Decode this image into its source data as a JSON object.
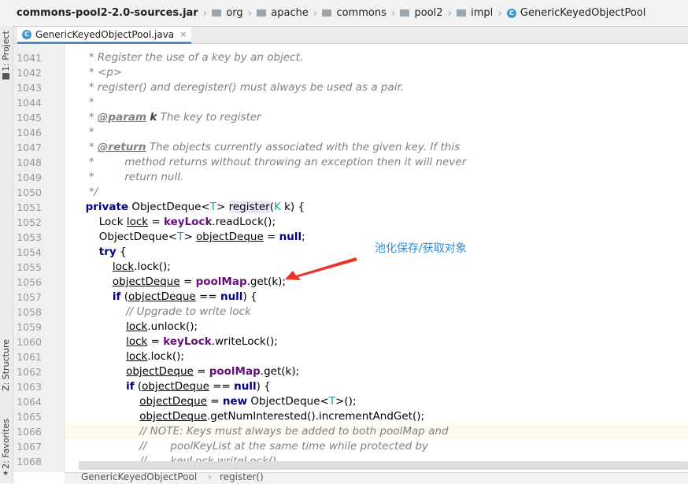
{
  "breadcrumbs": [
    {
      "label": "commons-pool2-2.0-sources.jar",
      "icon": "jar"
    },
    {
      "label": "org",
      "icon": "folder-icon"
    },
    {
      "label": "apache",
      "icon": "folder-icon"
    },
    {
      "label": "commons",
      "icon": "folder-icon"
    },
    {
      "label": "pool2",
      "icon": "folder-icon"
    },
    {
      "label": "impl",
      "icon": "folder-icon"
    },
    {
      "label": "GenericKeyedObjectPool",
      "icon": "class-icon"
    }
  ],
  "left_panel": {
    "project_tab": "1: Project",
    "structure_tab": "Z: Structure",
    "favorites_tab": "2: Favorites"
  },
  "editor_tab": {
    "label": "GenericKeyedObjectPool.java",
    "close": "×",
    "icon_letter": "C"
  },
  "line_numbers": [
    "1041",
    "1042",
    "1043",
    "1044",
    "1045",
    "1046",
    "1047",
    "1048",
    "1049",
    "1050",
    "1051",
    "1052",
    "1053",
    "1054",
    "1055",
    "1056",
    "1057",
    "1058",
    "1059",
    "1060",
    "1061",
    "1062",
    "1063",
    "1064",
    "1065",
    "1066",
    "1067",
    "1068"
  ],
  "code_lines": [
    [
      [
        "cm",
        "   * Register the use of a key by an object."
      ]
    ],
    [
      [
        "cm",
        "   * <p>"
      ]
    ],
    [
      [
        "cm",
        "   * register() and deregister() must always be used as a pair."
      ]
    ],
    [
      [
        "cm",
        "   *"
      ]
    ],
    [
      [
        "cm",
        "   * "
      ],
      [
        "doctag",
        "@param"
      ],
      [
        "cm",
        " "
      ],
      [
        "docparam",
        "k"
      ],
      [
        "cm",
        " The key to register"
      ]
    ],
    [
      [
        "cm",
        "   *"
      ]
    ],
    [
      [
        "cm",
        "   * "
      ],
      [
        "doctag",
        "@return"
      ],
      [
        "cm",
        " The objects currently associated with the given key. If this"
      ]
    ],
    [
      [
        "cm",
        "   *         method returns without throwing an exception then it will never"
      ]
    ],
    [
      [
        "cm",
        "   *         return null."
      ]
    ],
    [
      [
        "cm",
        "   */"
      ]
    ],
    [
      [
        "",
        "  "
      ],
      [
        "kw",
        "private"
      ],
      [
        "",
        " ObjectDeque<"
      ],
      [
        "tparam",
        "T"
      ],
      [
        "",
        "> "
      ],
      [
        "hlm",
        "register"
      ],
      [
        "",
        "("
      ],
      [
        "tparam",
        "K"
      ],
      [
        "",
        " k) {"
      ]
    ],
    [
      [
        "",
        "      Lock "
      ],
      [
        "ul",
        "lock"
      ],
      [
        "",
        " = "
      ],
      [
        "field",
        "keyLock"
      ],
      [
        "",
        ".readLock();"
      ]
    ],
    [
      [
        "",
        "      ObjectDeque<"
      ],
      [
        "tparam",
        "T"
      ],
      [
        "",
        "> "
      ],
      [
        "ul",
        "objectDeque"
      ],
      [
        "",
        " = "
      ],
      [
        "kw",
        "null"
      ],
      [
        "",
        ";"
      ]
    ],
    [
      [
        "",
        "      "
      ],
      [
        "kw",
        "try"
      ],
      [
        "",
        " {"
      ]
    ],
    [
      [
        "",
        "          "
      ],
      [
        "ul",
        "lock"
      ],
      [
        "",
        ".lock();"
      ]
    ],
    [
      [
        "",
        "          "
      ],
      [
        "ul",
        "objectDeque"
      ],
      [
        "",
        " = "
      ],
      [
        "field",
        "poolMap"
      ],
      [
        "",
        ".get(k);"
      ]
    ],
    [
      [
        "",
        "          "
      ],
      [
        "kw",
        "if"
      ],
      [
        "",
        " ("
      ],
      [
        "ul",
        "objectDeque"
      ],
      [
        "",
        " == "
      ],
      [
        "kw",
        "null"
      ],
      [
        "",
        ") {"
      ]
    ],
    [
      [
        "",
        "              "
      ],
      [
        "cm",
        "// Upgrade to write lock"
      ]
    ],
    [
      [
        "",
        "              "
      ],
      [
        "ul",
        "lock"
      ],
      [
        "",
        ".unlock();"
      ]
    ],
    [
      [
        "",
        "              "
      ],
      [
        "ul",
        "lock"
      ],
      [
        "",
        " = "
      ],
      [
        "field",
        "keyLock"
      ],
      [
        "",
        ".writeLock();"
      ]
    ],
    [
      [
        "",
        "              "
      ],
      [
        "ul",
        "lock"
      ],
      [
        "",
        ".lock();"
      ]
    ],
    [
      [
        "",
        "              "
      ],
      [
        "ul",
        "objectDeque"
      ],
      [
        "",
        " = "
      ],
      [
        "field",
        "poolMap"
      ],
      [
        "",
        ".get(k);"
      ]
    ],
    [
      [
        "",
        "              "
      ],
      [
        "kw",
        "if"
      ],
      [
        "",
        " ("
      ],
      [
        "ul",
        "objectDeque"
      ],
      [
        "",
        " == "
      ],
      [
        "kw",
        "null"
      ],
      [
        "",
        ") {"
      ]
    ],
    [
      [
        "",
        "                  "
      ],
      [
        "ul",
        "objectDeque"
      ],
      [
        "",
        " = "
      ],
      [
        "kw",
        "new"
      ],
      [
        "",
        " ObjectDeque<"
      ],
      [
        "tparam",
        "T"
      ],
      [
        "",
        ">();"
      ]
    ],
    [
      [
        "",
        "                  "
      ],
      [
        "ul",
        "objectDeque"
      ],
      [
        "",
        ".getNumInterested().incrementAndGet();"
      ]
    ],
    [
      [
        "",
        "                  "
      ],
      [
        "cm",
        "// NOTE: Keys must always be added to both poolMap and"
      ]
    ],
    [
      [
        "",
        "                  "
      ],
      [
        "cm",
        "//       poolKeyList at the same time while protected by"
      ]
    ],
    [
      [
        "",
        "                  "
      ],
      [
        "cm",
        "//       keyLock.writeLock()"
      ]
    ]
  ],
  "annotation": {
    "text": "池化保存/获取对象",
    "color": "#2f8bdc",
    "arrow_color": "#e8322a"
  },
  "status_bar": {
    "class_name": "GenericKeyedObjectPool",
    "separator": "›",
    "method_name": "register()"
  },
  "colors": {
    "keyword": "#000080",
    "field": "#660e7a",
    "comment": "#808080",
    "type_param": "#20999d",
    "tab_underline": "#4a88c7"
  }
}
